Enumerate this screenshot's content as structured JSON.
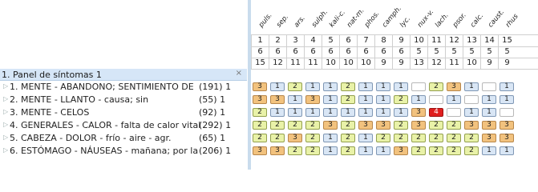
{
  "panel": {
    "title": "1. Panel de síntomas 1",
    "close_label": "×"
  },
  "symptoms": [
    {
      "label": "1. MENTE - ABANDONO; SENTIMIENTO DE",
      "count": "(191) 1"
    },
    {
      "label": "2. MENTE - LLANTO - causa; sin",
      "count": "(55) 1"
    },
    {
      "label": "3. MENTE - CELOS",
      "count": "(92) 1"
    },
    {
      "label": "4. GENERALES - CALOR - falta de calor vital",
      "count": "(292) 1"
    },
    {
      "label": "5. CABEZA - DOLOR - frío - aire - agr.",
      "count": "(65) 1"
    },
    {
      "label": "6. ESTÓMAGO - NÁUSEAS - mañana; por la",
      "count": "(206) 1"
    }
  ],
  "remedies": [
    "puls.",
    "sep.",
    "ars.",
    "sulph.",
    "kali-c.",
    "nat-m.",
    "phos.",
    "camph.",
    "lyc.",
    "nux-v.",
    "lach.",
    "psor.",
    "calc.",
    "caust.",
    "rhus"
  ],
  "rank": [
    "1",
    "2",
    "3",
    "4",
    "5",
    "6",
    "7",
    "8",
    "9",
    "10",
    "11",
    "12",
    "13",
    "14",
    "15"
  ],
  "symptoms_covered": [
    "6",
    "6",
    "6",
    "6",
    "6",
    "6",
    "6",
    "6",
    "6",
    "5",
    "5",
    "5",
    "5",
    "5",
    "5"
  ],
  "total_score": [
    "15",
    "12",
    "11",
    "11",
    "10",
    "10",
    "10",
    "9",
    "9",
    "13",
    "12",
    "11",
    "10",
    "9",
    "9"
  ],
  "grades": [
    [
      "3",
      "1",
      "2",
      "1",
      "1",
      "2",
      "1",
      "1",
      "1",
      "",
      "2",
      "3",
      "1",
      "",
      "1"
    ],
    [
      "3",
      "3",
      "1",
      "3",
      "1",
      "2",
      "1",
      "1",
      "2",
      "1",
      "",
      "1",
      "",
      "1",
      "1"
    ],
    [
      "2",
      "1",
      "1",
      "1",
      "1",
      "1",
      "1",
      "1",
      "1",
      "3",
      "4",
      "",
      "1",
      "1",
      ""
    ],
    [
      "2",
      "2",
      "2",
      "2",
      "3",
      "2",
      "3",
      "3",
      "2",
      "3",
      "2",
      "2",
      "3",
      "3",
      "3"
    ],
    [
      "2",
      "2",
      "3",
      "2",
      "1",
      "2",
      "1",
      "2",
      "2",
      "2",
      "2",
      "2",
      "2",
      "3",
      "3"
    ],
    [
      "3",
      "3",
      "2",
      "2",
      "1",
      "2",
      "1",
      "1",
      "3",
      "2",
      "2",
      "2",
      "2",
      "1",
      "1"
    ]
  ],
  "grade_colors": {
    "1": "#d9e6f5",
    "2": "#e9f2a8",
    "3": "#f2c27e",
    "4": "#e01e1e"
  }
}
